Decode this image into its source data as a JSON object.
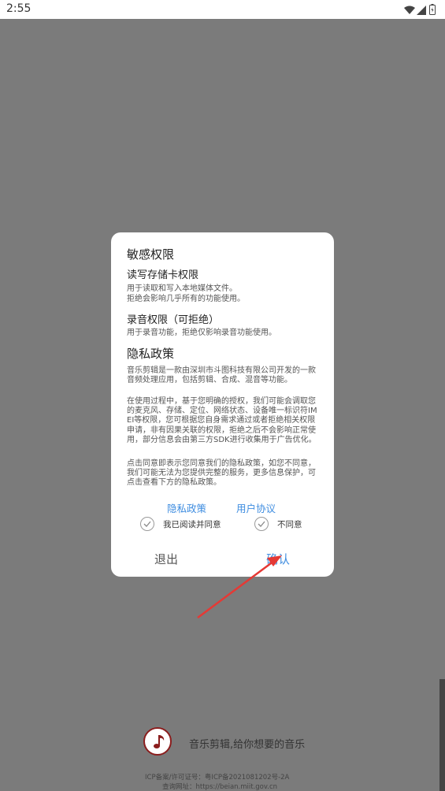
{
  "status_bar": {
    "time": "2:55"
  },
  "dialog": {
    "section_sensitive": "敏感权限",
    "storage_title": "读写存储卡权限",
    "storage_desc_1": "用于读取和写入本地媒体文件。",
    "storage_desc_2": "拒绝会影响几乎所有的功能使用。",
    "record_title": "录音权限（可拒绝）",
    "record_desc": "用于录音功能，拒绝仅影响录音功能使用。",
    "privacy_title": "隐私政策",
    "privacy_p1": "音乐剪辑是一款由深圳市斗图科技有限公司开发的一款音频处理应用，包括剪辑、合成、混音等功能。",
    "privacy_p2": " 在使用过程中，基于您明确的授权，我们可能会调取您的麦克风、存储、定位、网络状态、设备唯一标识符IMEI等权限，您可根据您自身需求通过或者拒绝相关权限申请，非有因果关联的权限，拒绝之后不会影响正常使用，部分信息会由第三方SDK进行收集用于广告优化。",
    "privacy_p3": " 点击同意即表示您同意我们的隐私政策，如您不同意，我们可能无法为您提供完整的服务，更多信息保护，可点击查看下方的隐私政策。",
    "link_privacy": "隐私政策",
    "link_agreement": "用户协议",
    "agree_label": "我已阅读并同意",
    "disagree_label": "不同意",
    "exit_button": "退出",
    "confirm_button": "确认"
  },
  "footer": {
    "slogan": "音乐剪辑,给你想要的音乐",
    "icp_line": "ICP备案/许可证号：粤ICP备2021081202号-2A",
    "query_line": "查询网址：https://beian.miit.gov.cn"
  },
  "colors": {
    "overlay": "#7b7b7b",
    "link": "#3f8de0",
    "arrow": "#e53935",
    "logo_ring": "#8b1d1d"
  }
}
